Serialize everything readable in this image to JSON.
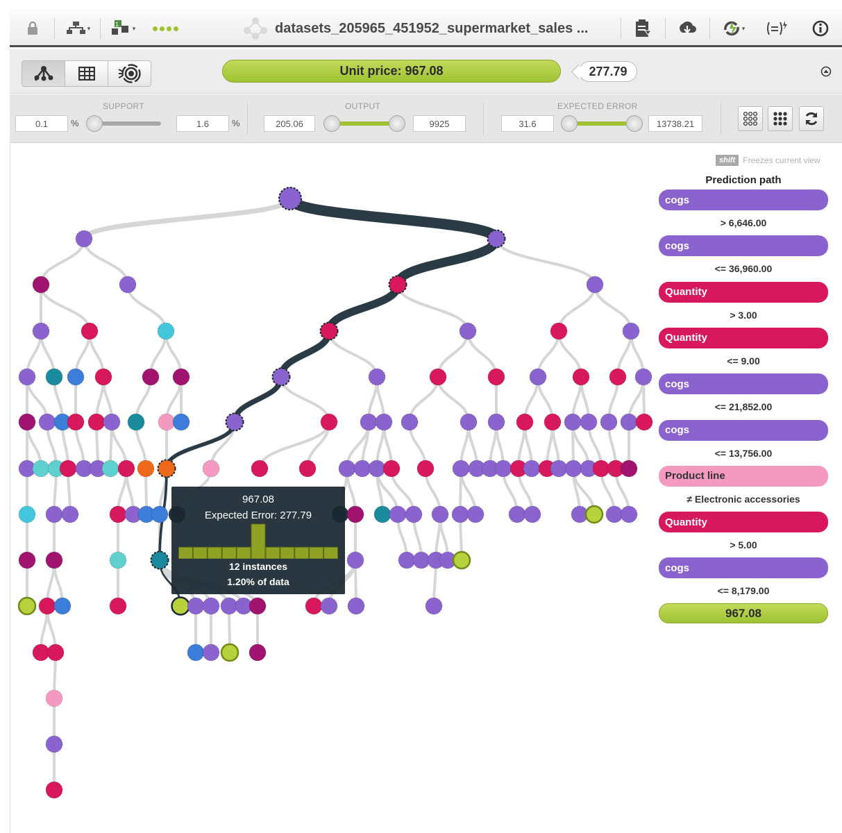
{
  "toolbar": {
    "title": "datasets_205965_451952_supermarket_sales ...",
    "icons": [
      "lock-icon",
      "tree-icon",
      "model-icon",
      "progress-dots",
      "dataset-icon",
      "clipboard-icon",
      "download-icon",
      "sunburst-icon",
      "formula-icon",
      "info-icon"
    ]
  },
  "view_modes": [
    "tree-view",
    "table-view",
    "sunburst-view"
  ],
  "prediction": {
    "label": "Unit price: 967.08",
    "error": "277.79"
  },
  "filters": {
    "support": {
      "label": "SUPPORT",
      "min": "0.1",
      "max": "1.6",
      "unit": "%"
    },
    "output": {
      "label": "OUTPUT",
      "min": "205.06",
      "max": "9925"
    },
    "expected_error": {
      "label": "EXPECTED ERROR",
      "min": "31.6",
      "max": "13738.21"
    }
  },
  "hint": {
    "key": "shift",
    "text": "Freezes current view"
  },
  "path_panel": {
    "title": "Prediction path",
    "steps": [
      {
        "field": "cogs",
        "cond": "> 6,646.00",
        "color": "#8a63cf"
      },
      {
        "field": "cogs",
        "cond": "<= 36,960.00",
        "color": "#8a63cf"
      },
      {
        "field": "Quantity",
        "cond": "> 3.00",
        "color": "#d8185c"
      },
      {
        "field": "Quantity",
        "cond": "<= 9.00",
        "color": "#d8185c"
      },
      {
        "field": "cogs",
        "cond": "<= 21,852.00",
        "color": "#8a63cf"
      },
      {
        "field": "cogs",
        "cond": "<= 13,756.00",
        "color": "#8a63cf"
      },
      {
        "field": "Product line",
        "cond": "≠ Electronic accessories",
        "color": "#f49ac1"
      },
      {
        "field": "Quantity",
        "cond": "> 5.00",
        "color": "#d8185c"
      },
      {
        "field": "cogs",
        "cond": "<= 8,179.00",
        "color": "#8a63cf"
      }
    ],
    "result": "967.08"
  },
  "tooltip": {
    "value": "967.08",
    "error": "Expected Error: 277.79",
    "instances": "12 instances",
    "percent": "1.20% of data",
    "histogram": [
      1,
      1,
      1,
      1,
      1,
      3,
      1,
      1,
      1,
      1,
      1
    ]
  },
  "colors": {
    "cogs": "#8a63cf",
    "quantity": "#d8185c",
    "product_line": "#f49ac1",
    "leaf": "#b8d23e",
    "path": "#2a3b45",
    "edge": "#d6d6d6"
  }
}
